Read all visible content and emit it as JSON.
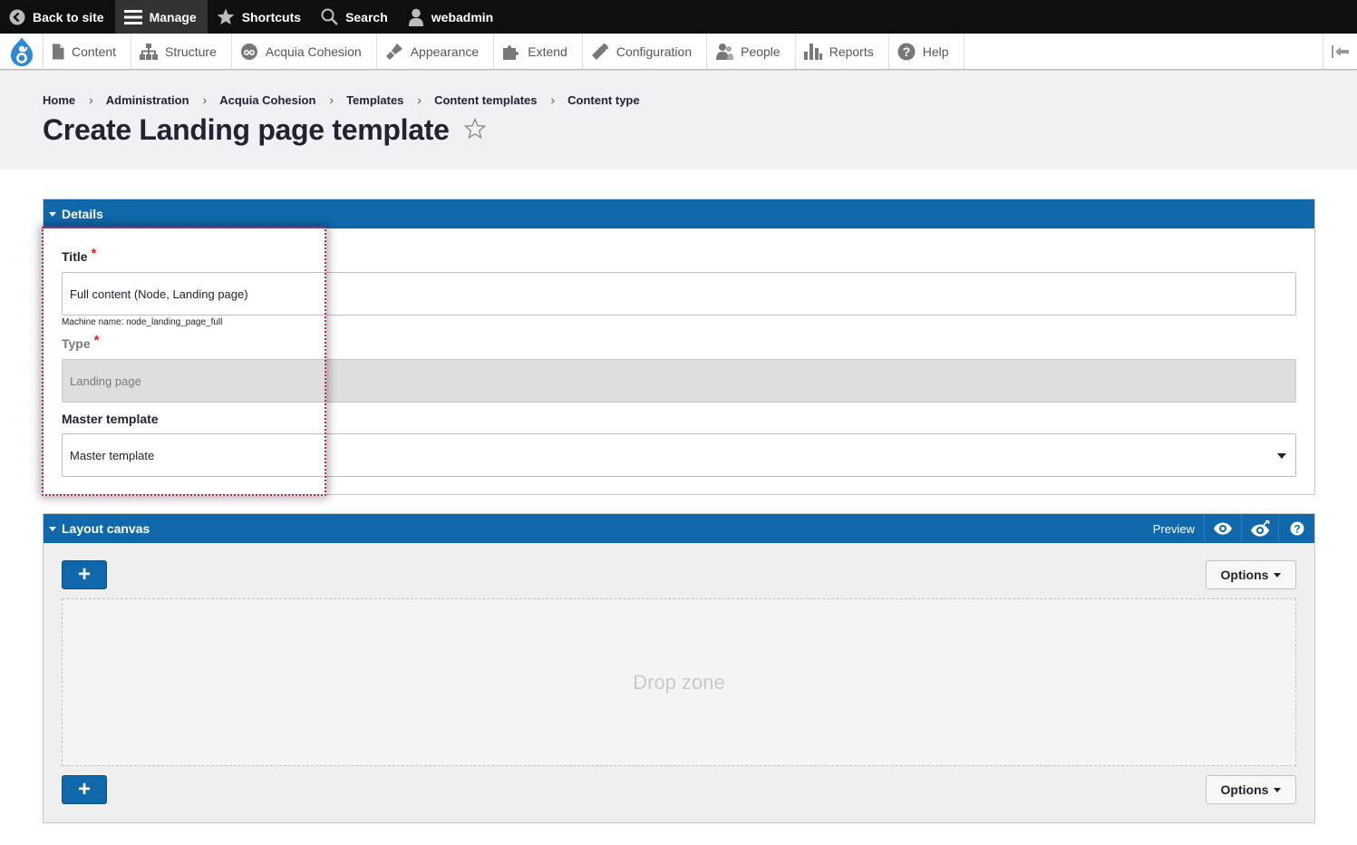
{
  "topbar": {
    "back_label": "Back to site",
    "manage_label": "Manage",
    "shortcuts_label": "Shortcuts",
    "search_label": "Search",
    "user_label": "webadmin"
  },
  "tray": {
    "items": [
      {
        "label": "Content",
        "icon": "document-icon"
      },
      {
        "label": "Structure",
        "icon": "structure-icon"
      },
      {
        "label": "Acquia Cohesion",
        "icon": "cohesion-icon"
      },
      {
        "label": "Appearance",
        "icon": "paintbrush-icon"
      },
      {
        "label": "Extend",
        "icon": "puzzle-icon"
      },
      {
        "label": "Configuration",
        "icon": "wrench-icon"
      },
      {
        "label": "People",
        "icon": "people-icon"
      },
      {
        "label": "Reports",
        "icon": "bar-chart-icon"
      },
      {
        "label": "Help",
        "icon": "help-icon"
      }
    ]
  },
  "breadcrumb": [
    "Home",
    "Administration",
    "Acquia Cohesion",
    "Templates",
    "Content templates",
    "Content type"
  ],
  "page": {
    "title": "Create Landing page template"
  },
  "details": {
    "heading": "Details",
    "title_label": "Title",
    "title_value": "Full content (Node, Landing page)",
    "machine_name": "Machine name: node_landing_page_full",
    "type_label": "Type",
    "type_value": "Landing page",
    "master_label": "Master template",
    "master_value": "Master template",
    "required_mark": "*"
  },
  "canvas": {
    "heading": "Layout canvas",
    "preview_label": "Preview",
    "add_label": "+",
    "options_label": "Options",
    "dropzone_label": "Drop zone"
  },
  "colors": {
    "accent": "#1068ab",
    "highlight": "#cc1d6b",
    "required": "#dc2323"
  }
}
